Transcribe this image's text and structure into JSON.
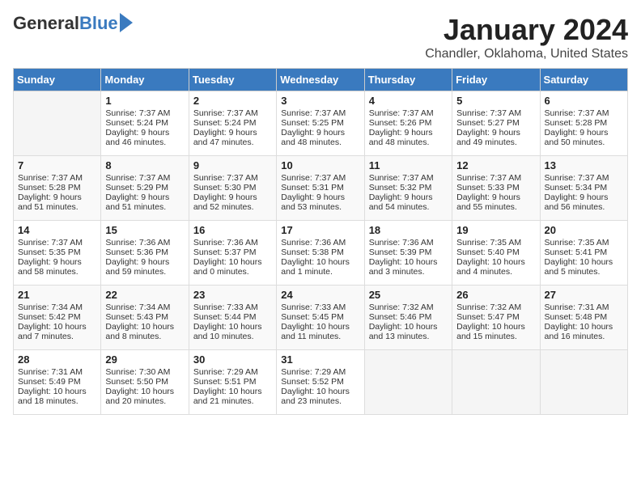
{
  "header": {
    "logo_general": "General",
    "logo_blue": "Blue",
    "title": "January 2024",
    "subtitle": "Chandler, Oklahoma, United States"
  },
  "days_of_week": [
    "Sunday",
    "Monday",
    "Tuesday",
    "Wednesday",
    "Thursday",
    "Friday",
    "Saturday"
  ],
  "weeks": [
    [
      {
        "day": "",
        "empty": true
      },
      {
        "day": "1",
        "sunrise": "Sunrise: 7:37 AM",
        "sunset": "Sunset: 5:24 PM",
        "daylight": "Daylight: 9 hours and 46 minutes."
      },
      {
        "day": "2",
        "sunrise": "Sunrise: 7:37 AM",
        "sunset": "Sunset: 5:24 PM",
        "daylight": "Daylight: 9 hours and 47 minutes."
      },
      {
        "day": "3",
        "sunrise": "Sunrise: 7:37 AM",
        "sunset": "Sunset: 5:25 PM",
        "daylight": "Daylight: 9 hours and 48 minutes."
      },
      {
        "day": "4",
        "sunrise": "Sunrise: 7:37 AM",
        "sunset": "Sunset: 5:26 PM",
        "daylight": "Daylight: 9 hours and 48 minutes."
      },
      {
        "day": "5",
        "sunrise": "Sunrise: 7:37 AM",
        "sunset": "Sunset: 5:27 PM",
        "daylight": "Daylight: 9 hours and 49 minutes."
      },
      {
        "day": "6",
        "sunrise": "Sunrise: 7:37 AM",
        "sunset": "Sunset: 5:28 PM",
        "daylight": "Daylight: 9 hours and 50 minutes."
      }
    ],
    [
      {
        "day": "7",
        "sunrise": "Sunrise: 7:37 AM",
        "sunset": "Sunset: 5:28 PM",
        "daylight": "Daylight: 9 hours and 51 minutes."
      },
      {
        "day": "8",
        "sunrise": "Sunrise: 7:37 AM",
        "sunset": "Sunset: 5:29 PM",
        "daylight": "Daylight: 9 hours and 51 minutes."
      },
      {
        "day": "9",
        "sunrise": "Sunrise: 7:37 AM",
        "sunset": "Sunset: 5:30 PM",
        "daylight": "Daylight: 9 hours and 52 minutes."
      },
      {
        "day": "10",
        "sunrise": "Sunrise: 7:37 AM",
        "sunset": "Sunset: 5:31 PM",
        "daylight": "Daylight: 9 hours and 53 minutes."
      },
      {
        "day": "11",
        "sunrise": "Sunrise: 7:37 AM",
        "sunset": "Sunset: 5:32 PM",
        "daylight": "Daylight: 9 hours and 54 minutes."
      },
      {
        "day": "12",
        "sunrise": "Sunrise: 7:37 AM",
        "sunset": "Sunset: 5:33 PM",
        "daylight": "Daylight: 9 hours and 55 minutes."
      },
      {
        "day": "13",
        "sunrise": "Sunrise: 7:37 AM",
        "sunset": "Sunset: 5:34 PM",
        "daylight": "Daylight: 9 hours and 56 minutes."
      }
    ],
    [
      {
        "day": "14",
        "sunrise": "Sunrise: 7:37 AM",
        "sunset": "Sunset: 5:35 PM",
        "daylight": "Daylight: 9 hours and 58 minutes."
      },
      {
        "day": "15",
        "sunrise": "Sunrise: 7:36 AM",
        "sunset": "Sunset: 5:36 PM",
        "daylight": "Daylight: 9 hours and 59 minutes."
      },
      {
        "day": "16",
        "sunrise": "Sunrise: 7:36 AM",
        "sunset": "Sunset: 5:37 PM",
        "daylight": "Daylight: 10 hours and 0 minutes."
      },
      {
        "day": "17",
        "sunrise": "Sunrise: 7:36 AM",
        "sunset": "Sunset: 5:38 PM",
        "daylight": "Daylight: 10 hours and 1 minute."
      },
      {
        "day": "18",
        "sunrise": "Sunrise: 7:36 AM",
        "sunset": "Sunset: 5:39 PM",
        "daylight": "Daylight: 10 hours and 3 minutes."
      },
      {
        "day": "19",
        "sunrise": "Sunrise: 7:35 AM",
        "sunset": "Sunset: 5:40 PM",
        "daylight": "Daylight: 10 hours and 4 minutes."
      },
      {
        "day": "20",
        "sunrise": "Sunrise: 7:35 AM",
        "sunset": "Sunset: 5:41 PM",
        "daylight": "Daylight: 10 hours and 5 minutes."
      }
    ],
    [
      {
        "day": "21",
        "sunrise": "Sunrise: 7:34 AM",
        "sunset": "Sunset: 5:42 PM",
        "daylight": "Daylight: 10 hours and 7 minutes."
      },
      {
        "day": "22",
        "sunrise": "Sunrise: 7:34 AM",
        "sunset": "Sunset: 5:43 PM",
        "daylight": "Daylight: 10 hours and 8 minutes."
      },
      {
        "day": "23",
        "sunrise": "Sunrise: 7:33 AM",
        "sunset": "Sunset: 5:44 PM",
        "daylight": "Daylight: 10 hours and 10 minutes."
      },
      {
        "day": "24",
        "sunrise": "Sunrise: 7:33 AM",
        "sunset": "Sunset: 5:45 PM",
        "daylight": "Daylight: 10 hours and 11 minutes."
      },
      {
        "day": "25",
        "sunrise": "Sunrise: 7:32 AM",
        "sunset": "Sunset: 5:46 PM",
        "daylight": "Daylight: 10 hours and 13 minutes."
      },
      {
        "day": "26",
        "sunrise": "Sunrise: 7:32 AM",
        "sunset": "Sunset: 5:47 PM",
        "daylight": "Daylight: 10 hours and 15 minutes."
      },
      {
        "day": "27",
        "sunrise": "Sunrise: 7:31 AM",
        "sunset": "Sunset: 5:48 PM",
        "daylight": "Daylight: 10 hours and 16 minutes."
      }
    ],
    [
      {
        "day": "28",
        "sunrise": "Sunrise: 7:31 AM",
        "sunset": "Sunset: 5:49 PM",
        "daylight": "Daylight: 10 hours and 18 minutes."
      },
      {
        "day": "29",
        "sunrise": "Sunrise: 7:30 AM",
        "sunset": "Sunset: 5:50 PM",
        "daylight": "Daylight: 10 hours and 20 minutes."
      },
      {
        "day": "30",
        "sunrise": "Sunrise: 7:29 AM",
        "sunset": "Sunset: 5:51 PM",
        "daylight": "Daylight: 10 hours and 21 minutes."
      },
      {
        "day": "31",
        "sunrise": "Sunrise: 7:29 AM",
        "sunset": "Sunset: 5:52 PM",
        "daylight": "Daylight: 10 hours and 23 minutes."
      },
      {
        "day": "",
        "empty": true
      },
      {
        "day": "",
        "empty": true
      },
      {
        "day": "",
        "empty": true
      }
    ]
  ]
}
